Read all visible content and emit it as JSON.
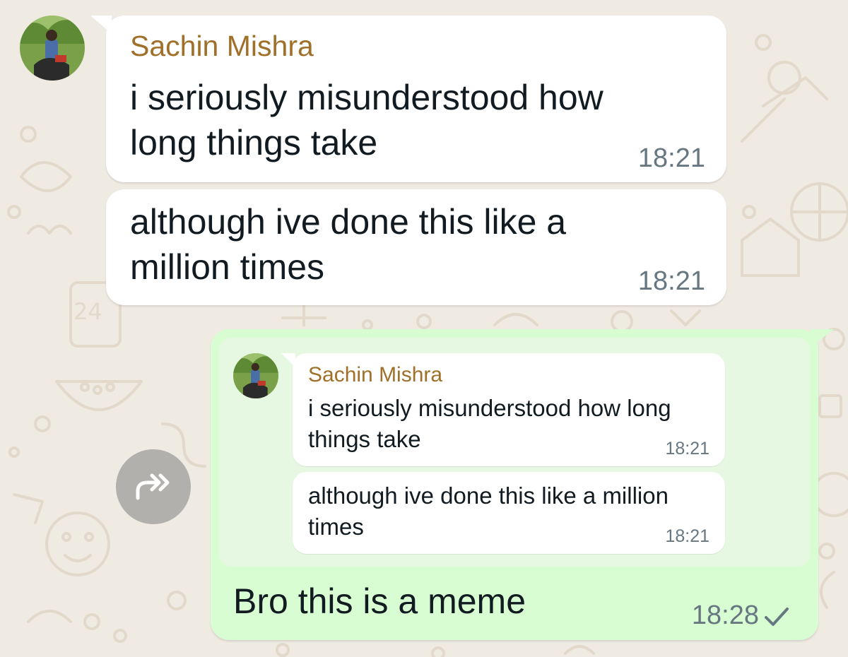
{
  "chat": {
    "incoming": [
      {
        "sender": "Sachin Mishra",
        "text": "i seriously misunderstood how long things take",
        "time": "18:21"
      },
      {
        "text": "although ive done this like a million times",
        "time": "18:21"
      }
    ],
    "outgoing": {
      "forwarded": [
        {
          "sender": "Sachin Mishra",
          "text": "i seriously misunderstood how long things take",
          "time": "18:21"
        },
        {
          "text": "although ive done this like a million times",
          "time": "18:21"
        }
      ],
      "text": "Bro this is a meme",
      "time": "18:28",
      "status_icon": "single-check-icon"
    }
  },
  "colors": {
    "background": "#efeae2",
    "incoming_bubble": "#ffffff",
    "outgoing_bubble": "#d9fdd3",
    "sender_name": "#a0702a",
    "timestamp": "#667781"
  },
  "icons": {
    "forward": "forward-arrow-icon",
    "avatar": "avatar"
  }
}
